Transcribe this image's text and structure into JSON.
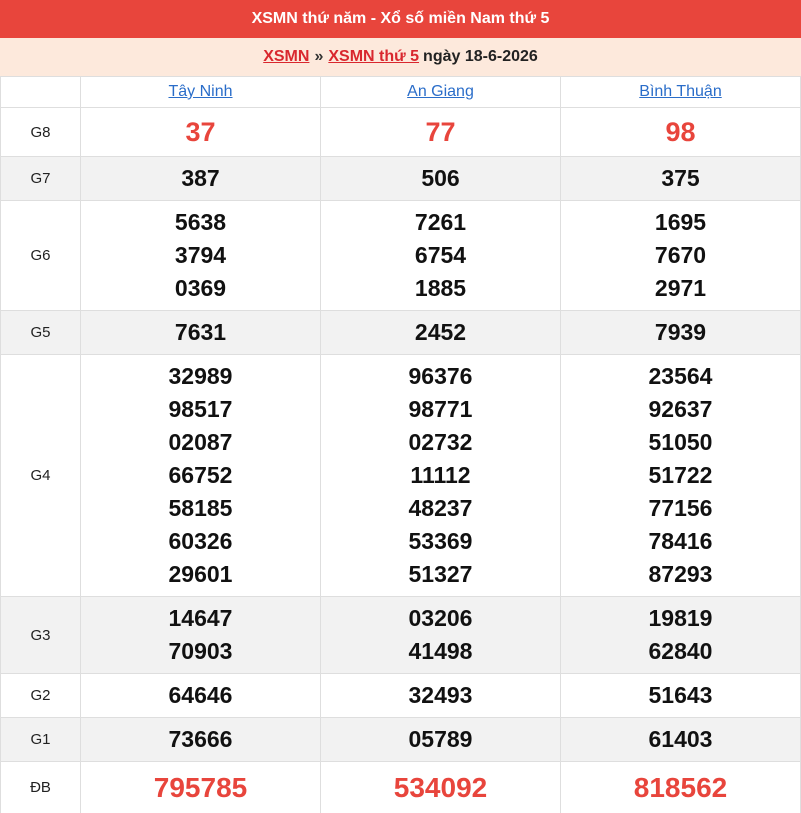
{
  "header": {
    "title": "XSMN thứ năm - Xổ số miền Nam thứ 5"
  },
  "breadcrumb": {
    "link1": "XSMN",
    "separator": "»",
    "link2": "XSMN thứ 5",
    "date_text": "ngày 18-6-2026"
  },
  "provinces": [
    "Tây Ninh",
    "An Giang",
    "Bình Thuận"
  ],
  "prizes": {
    "g8": {
      "label": "G8",
      "values": [
        [
          "37"
        ],
        [
          "77"
        ],
        [
          "98"
        ]
      ]
    },
    "g7": {
      "label": "G7",
      "values": [
        [
          "387"
        ],
        [
          "506"
        ],
        [
          "375"
        ]
      ]
    },
    "g6": {
      "label": "G6",
      "values": [
        [
          "5638",
          "3794",
          "0369"
        ],
        [
          "7261",
          "6754",
          "1885"
        ],
        [
          "1695",
          "7670",
          "2971"
        ]
      ]
    },
    "g5": {
      "label": "G5",
      "values": [
        [
          "7631"
        ],
        [
          "2452"
        ],
        [
          "7939"
        ]
      ]
    },
    "g4": {
      "label": "G4",
      "values": [
        [
          "32989",
          "98517",
          "02087",
          "66752",
          "58185",
          "60326",
          "29601"
        ],
        [
          "96376",
          "98771",
          "02732",
          "11112",
          "48237",
          "53369",
          "51327"
        ],
        [
          "23564",
          "92637",
          "51050",
          "51722",
          "77156",
          "78416",
          "87293"
        ]
      ]
    },
    "g3": {
      "label": "G3",
      "values": [
        [
          "14647",
          "70903"
        ],
        [
          "03206",
          "41498"
        ],
        [
          "19819",
          "62840"
        ]
      ]
    },
    "g2": {
      "label": "G2",
      "values": [
        [
          "64646"
        ],
        [
          "32493"
        ],
        [
          "51643"
        ]
      ]
    },
    "g1": {
      "label": "G1",
      "values": [
        [
          "73666"
        ],
        [
          "05789"
        ],
        [
          "61403"
        ]
      ]
    },
    "db": {
      "label": "ĐB",
      "values": [
        [
          "795785"
        ],
        [
          "534092"
        ],
        [
          "818562"
        ]
      ]
    }
  },
  "colors": {
    "header_bg": "#e8453c",
    "breadcrumb_bg": "#fde9dc",
    "link_red": "#d9272e",
    "province_link": "#2a6dc9",
    "highlight_number": "#e8453c",
    "alt_row_bg": "#f2f2f2"
  }
}
